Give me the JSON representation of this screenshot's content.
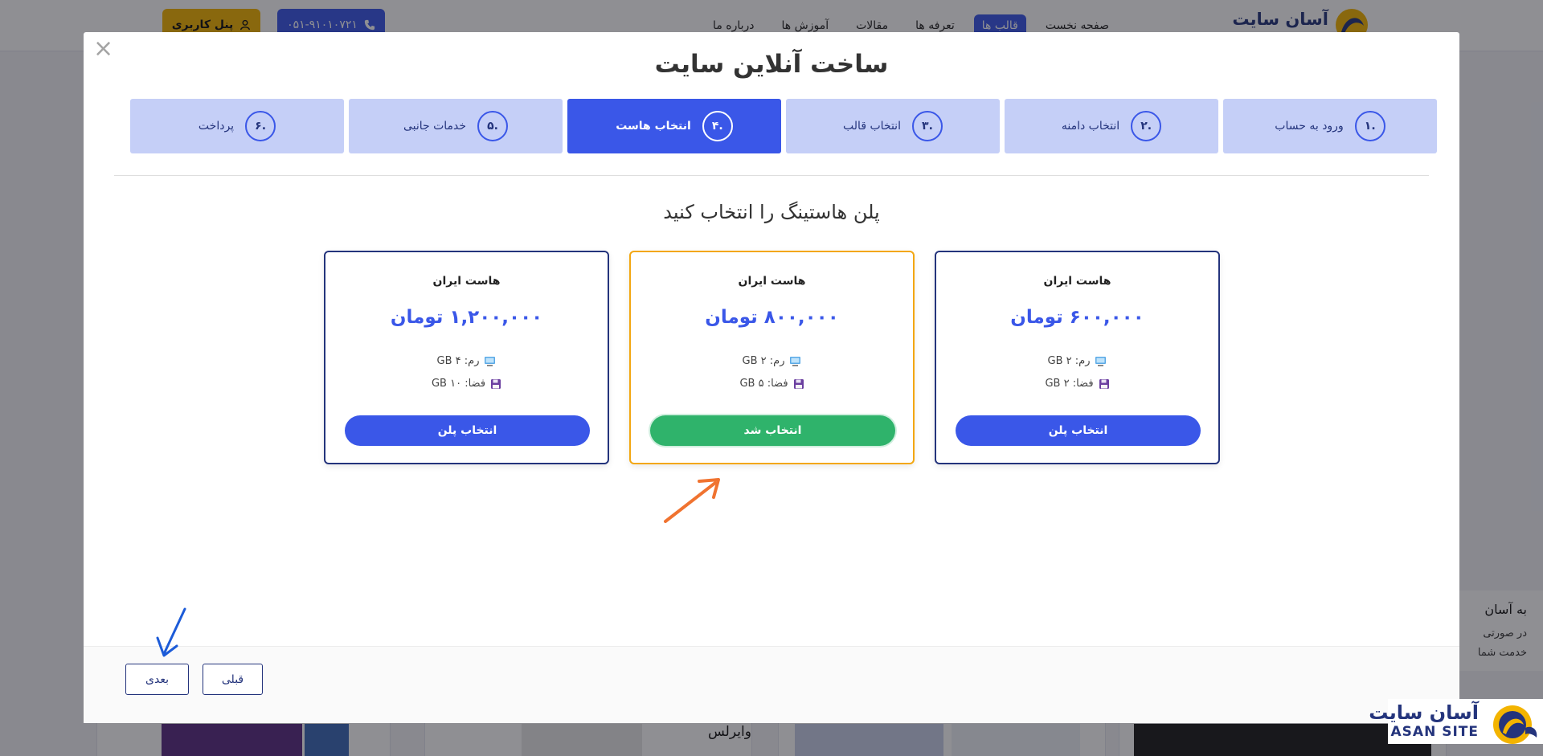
{
  "site": {
    "logo_text": "آسان سایت",
    "nav": [
      "صفحه نخست",
      "قالب ها",
      "تعرفه ها",
      "مقالات",
      "آموزش ها",
      "درباره ما"
    ],
    "nav_active": "قالب ها",
    "phone": "۰۵۱-۹۱۰۱۰۷۲۱",
    "panel_label": "پنل کاربری",
    "bg_card_text": "وایرلس",
    "chat_title": "به آسان",
    "chat_line1": "در صورتی",
    "chat_line2": "خدمت شما"
  },
  "modal": {
    "title": "ساخت آنلاین سایت",
    "close_symbol": "×",
    "steps": [
      {
        "num": ".۱",
        "label": "ورود به حساب",
        "active": false
      },
      {
        "num": ".۲",
        "label": "انتخاب دامنه",
        "active": false
      },
      {
        "num": ".۳",
        "label": "انتخاب قالب",
        "active": false
      },
      {
        "num": ".۴",
        "label": "انتخاب هاست",
        "active": true
      },
      {
        "num": ".۵",
        "label": "خدمات جانبی",
        "active": false
      },
      {
        "num": ".۶",
        "label": "پرداخت",
        "active": false
      }
    ],
    "section_title": "پلن هاستینگ را انتخاب کنید",
    "plans": [
      {
        "name": "هاست ایران",
        "price": "۶۰۰,۰۰۰ تومان",
        "ram": "رم: ۲ GB",
        "disk": "فضا: ۲ GB",
        "button": "انتخاب پلن",
        "selected": false
      },
      {
        "name": "هاست ایران",
        "price": "۸۰۰,۰۰۰ تومان",
        "ram": "رم: ۲ GB",
        "disk": "فضا: ۵ GB",
        "button": "انتخاب شد",
        "selected": true
      },
      {
        "name": "هاست ایران",
        "price": "۱,۲۰۰,۰۰۰ تومان",
        "ram": "رم: ۴ GB",
        "disk": "فضا: ۱۰ GB",
        "button": "انتخاب پلن",
        "selected": false
      }
    ],
    "prev_label": "قبلی",
    "next_label": "بعدی"
  },
  "corner_logo": {
    "fa": "آسان سایت",
    "en": "ASAN SITE"
  },
  "colors": {
    "primary": "#3a57e8",
    "step_inactive": "#c5cff7",
    "selected_border": "#f3a712",
    "chosen_button": "#2fb36b",
    "panel_button": "#f3b400",
    "arrow_orange": "#f07330",
    "arrow_blue": "#1c5bd8",
    "navy": "#24347c"
  },
  "icons": {
    "phone": "phone-icon",
    "user": "user-icon",
    "ram": "computer-icon",
    "disk": "floppy-disk-icon",
    "close": "close-icon"
  }
}
